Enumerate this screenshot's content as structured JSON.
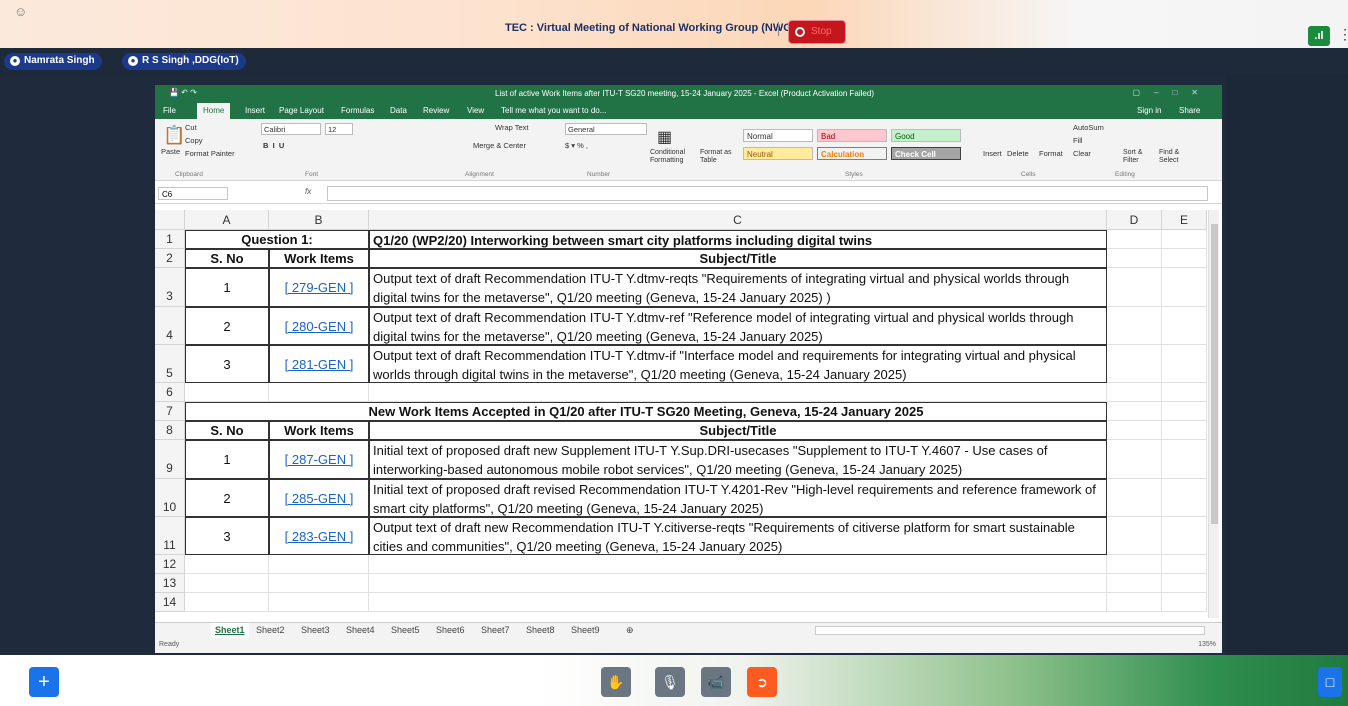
{
  "meeting": {
    "title": "TEC : Virtual Meeting of National Working Group (NWG-20)",
    "divider": "|",
    "record_label": "Stop",
    "participants": [
      "Namrata Singh",
      "R S Singh ,DDG(IoT)"
    ],
    "signal_icon": "signal-bars-icon",
    "more_icon": "⋮"
  },
  "excel": {
    "window_title": "List of active Work Items after  ITU-T SG20  meeting, 15-24 January 2025 - Excel (Product Activation Failed)",
    "menu_tabs": [
      "File",
      "Home",
      "Insert",
      "Page Layout",
      "Formulas",
      "Data",
      "Review",
      "View",
      "Tell me what you want to do..."
    ],
    "sign_in": "Sign in",
    "share": "Share",
    "ribbon": {
      "clipboard": {
        "paste": "Paste",
        "cut": "Cut",
        "copy": "Copy",
        "format_painter": "Format Painter",
        "group": "Clipboard"
      },
      "font": {
        "name": "Calibri",
        "size": "12",
        "group": "Font"
      },
      "alignment": {
        "wrap_text": "Wrap Text",
        "merge": "Merge & Center",
        "group": "Alignment"
      },
      "number": {
        "format": "General",
        "group": "Number"
      },
      "styles": {
        "conditional": "Conditional Formatting",
        "format_table": "Format as Table",
        "normal": "Normal",
        "bad": "Bad",
        "good": "Good",
        "neutral": "Neutral",
        "calculation": "Calculation",
        "check_cell": "Check Cell",
        "group": "Styles"
      },
      "cells": {
        "insert": "Insert",
        "delete": "Delete",
        "format": "Format",
        "group": "Cells"
      },
      "editing": {
        "autosum": "AutoSum",
        "fill": "Fill",
        "clear": "Clear",
        "sort": "Sort & Filter",
        "find": "Find & Select",
        "group": "Editing"
      }
    },
    "name_box": "C6",
    "fx": "fx",
    "columns": [
      "A",
      "B",
      "C",
      "D",
      "E"
    ],
    "rows": {
      "r1": {
        "num": "1",
        "a": "Question 1:",
        "c": "Q1/20 (WP2/20) Interworking between smart city platforms including digital twins"
      },
      "r2": {
        "num": "2",
        "a": "S. No",
        "b": "Work Items",
        "c": "Subject/Title"
      },
      "r3": {
        "num": "3",
        "a": "1",
        "b": "[ 279-GEN ]",
        "c": "Output text of draft Recommendation ITU-T Y.dtmv-reqts \"Requirements of integrating virtual and physical worlds through digital twins for the metaverse\", Q1/20 meeting (Geneva, 15-24 January 2025)  )"
      },
      "r4": {
        "num": "4",
        "a": "2",
        "b": "[ 280-GEN ]",
        "c": "Output text of draft Recommendation ITU-T Y.dtmv-ref \"Reference model of integrating virtual and physical worlds through digital twins for the metaverse\", Q1/20 meeting (Geneva, 15-24 January 2025)"
      },
      "r5": {
        "num": "5",
        "a": "3",
        "b": "[ 281-GEN ]",
        "c": "Output text of draft Recommendation ITU-T Y.dtmv-if \"Interface model and requirements for integrating virtual and physical worlds through digital twins in the metaverse\", Q1/20 meeting (Geneva, 15-24 January 2025)"
      },
      "r6": {
        "num": "6"
      },
      "r7": {
        "num": "7",
        "c": "New Work Items Accepted in Q1/20 after ITU-T SG20 Meeting, Geneva, 15-24 January 2025"
      },
      "r8": {
        "num": "8",
        "a": "S. No",
        "b": "Work Items",
        "c": "Subject/Title"
      },
      "r9": {
        "num": "9",
        "a": "1",
        "b": "[ 287-GEN ]",
        "c": "Initial text of proposed draft new Supplement ITU-T Y.Sup.DRI-usecases \"Supplement to ITU-T Y.4607 - Use cases of interworking-based autonomous mobile robot services\", Q1/20 meeting (Geneva, 15-24 January 2025)"
      },
      "r10": {
        "num": "10",
        "a": "2",
        "b": "[ 285-GEN ]",
        "c": "Initial text of proposed draft revised Recommendation ITU-T Y.4201-Rev \"High-level requirements and reference framework of smart city platforms\", Q1/20 meeting (Geneva, 15-24 January 2025)"
      },
      "r11": {
        "num": "11",
        "a": "3",
        "b": "[ 283-GEN ]",
        "c": "Output text of draft new Recommendation ITU-T Y.citiverse-reqts \"Requirements of citiverse platform for smart sustainable cities and communities\", Q1/20 meeting (Geneva, 15-24 January 2025)"
      },
      "r12": {
        "num": "12"
      },
      "r13": {
        "num": "13"
      },
      "r14": {
        "num": "14"
      }
    },
    "sheets": [
      "Sheet1",
      "Sheet2",
      "Sheet3",
      "Sheet4",
      "Sheet5",
      "Sheet6",
      "Sheet7",
      "Sheet8",
      "Sheet9"
    ],
    "status": "Ready",
    "zoom": "135%"
  },
  "controls": {
    "add_icon": "+",
    "hand_icon": "raise-hand-icon",
    "mic_icon": "mic-off-icon",
    "video_icon": "video-off-icon",
    "leave_icon": "leave-icon",
    "chat_icon": "chat-icon"
  },
  "colors": {
    "excel_green": "#217346",
    "record_red": "#c4161c",
    "leave_orange": "#ff5a1f",
    "chip_blue": "#1d3a8a"
  }
}
